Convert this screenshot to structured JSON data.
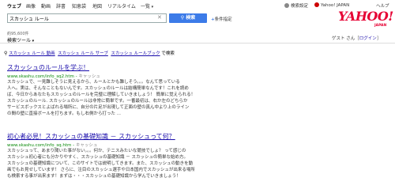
{
  "nav": {
    "items": [
      "ウェブ",
      "画像",
      "動画",
      "辞書",
      "知恵袋",
      "地図",
      "リアルタイム",
      "一覧"
    ]
  },
  "topright": {
    "settings": "検索設定",
    "yahoo_japan": "Yahoo! JAPAN",
    "help": "ヘルプ"
  },
  "search": {
    "query": "スカッシュ ルール",
    "button_label": "検索",
    "condition_label": "条件指定"
  },
  "logo": {
    "text": "YAHOO!",
    "sub": "JAPAN"
  },
  "result_count": "約95,600件",
  "tools_label": "検索ツール",
  "guest": {
    "name": "ゲスト",
    "honorific": "さん",
    "login": "ログイン"
  },
  "related": {
    "items": [
      "スカッシュ ルール 動画",
      "スカッシュ ルール サーブ",
      "スカッシュ ルールブック"
    ],
    "suffix": "で検索"
  },
  "results": [
    {
      "title": "スカッシュのルールを学ぶ！",
      "url": "www.skashu.com/info_sq2.htm",
      "cache": "キャッシュ",
      "lines": [
        "スカッシュで、一見難しそうに見えるから、ルールとかも難しそう。。。なんて思っている",
        "人へ。実は、そんなこともないんです。スカッシュのルールは結構簡単なんです！これを読め",
        "ば、今日からあなたもスカッシュのルールを完璧に理解していきましょう！ 簡単に覚えられる！",
        "スカッシュのルール. スカッシュのルールは非常に簡単です。一番最初は、右か左のどちらか",
        "サービスボックスとよばれる場所に、自分の片足が出現して正面の壁の真ん中より上のライン",
        "の間の壁に直接ボールを打ちます。もし右側から打った ..."
      ]
    },
    {
      "title": "初心者必見！スカッシュの基礎知識 － スカッシュって何？",
      "url": "www.skashu.com/info_sq.htm",
      "cache": "キャッシュ",
      "lines": [
        "スカッシュって、あまり聞いた事がない。。。何か、テニスみたいな競技でしょ？ って感じの",
        "スカッシュ初心者にも分かりやすく、スカッシュの基礎知識 － スカッシュの簡単な始め方。",
        "スカッシュの基礎知識について、このサイトでは説明してきます。また、スカッシュの動きを動",
        "画でもお見せしています！ さらに、注目のスカッシュ選手や日本国内でスカッシュが出来る場所",
        "も検索する事が出来ます！まずは・・・スカッシュの基礎知識から学んでいきましょう！"
      ]
    }
  ],
  "colors": {
    "accent": "#3c7be8",
    "link": "#1a0dab",
    "url": "#0a8a0a",
    "logo": "#e60033"
  }
}
